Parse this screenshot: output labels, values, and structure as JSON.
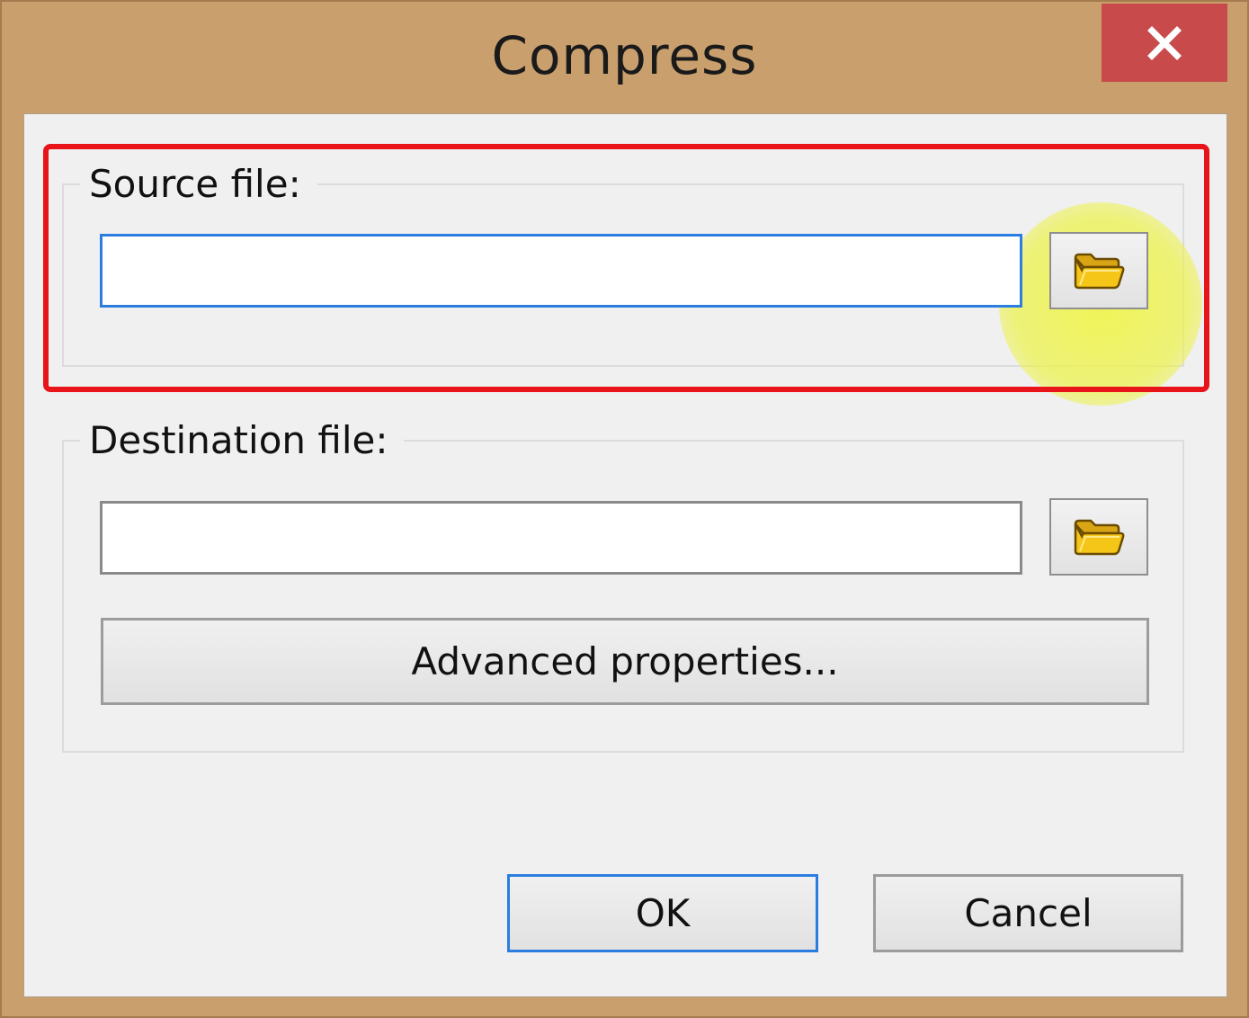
{
  "window": {
    "title": "Compress"
  },
  "titlebar": {
    "close_icon": "close-icon"
  },
  "source": {
    "label": "Source file:",
    "value": "",
    "browse_icon": "folder-icon"
  },
  "destination": {
    "label": "Destination file:",
    "value": "",
    "browse_icon": "folder-icon",
    "advanced_label": "Advanced properties..."
  },
  "footer": {
    "ok_label": "OK",
    "cancel_label": "Cancel"
  },
  "colors": {
    "window_frame": "#c99f6e",
    "close_button": "#c94a4a",
    "focus_border": "#2b7de0",
    "annotation_red": "#e8141a",
    "highlight_yellow": "#eef23c",
    "folder_yellow": "#f5c518"
  }
}
